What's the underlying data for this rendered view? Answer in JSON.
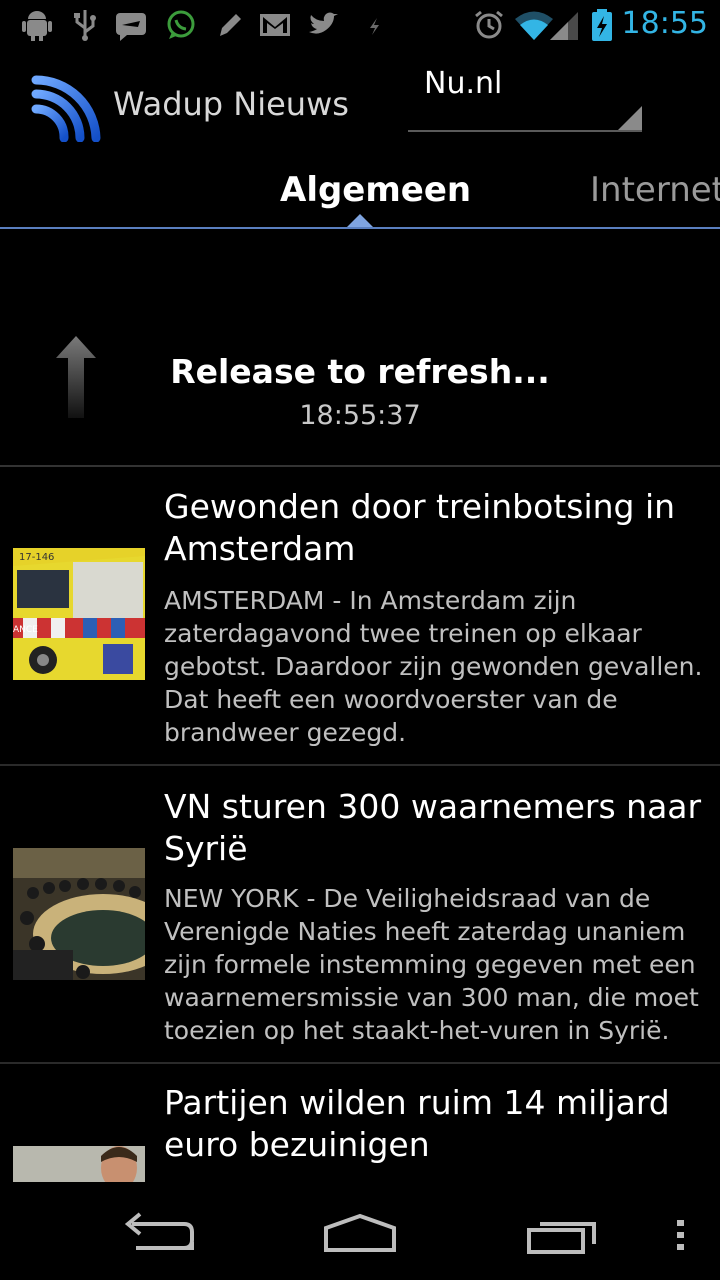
{
  "status_bar": {
    "time": "18:55",
    "left_icons": [
      "android-debug-icon",
      "usb-icon",
      "airplane-message-icon",
      "whatsapp-icon",
      "pencil-icon",
      "gmail-icon",
      "twitter-icon",
      "small-notification-icon"
    ],
    "right_icons": [
      "alarm-icon",
      "wifi-icon",
      "signal-icon",
      "battery-charging-icon"
    ]
  },
  "action_bar": {
    "app_title": "Wadup Nieuws",
    "source_selected": "Nu.nl"
  },
  "tabs": [
    {
      "label": "Algemeen",
      "selected": true
    },
    {
      "label": "Internet",
      "selected": false
    }
  ],
  "pull_to_refresh": {
    "message": "Release to refresh...",
    "time": "18:55:37"
  },
  "news": [
    {
      "headline": "Gewonden door treinbotsing in Amsterdam",
      "summary": "AMSTERDAM - In Amsterdam zijn zaterdagavond twee treinen op elkaar gebotst. Daardoor zijn gewonden gevallen. Dat heeft een woordvoerster van de brandweer gezegd.",
      "thumb_badge": "17-146",
      "thumb_side_text": "ANCE"
    },
    {
      "headline": "VN sturen 300 waarnemers naar Syrië",
      "summary": "NEW YORK - De Veiligheidsraad van de Verenigde Naties heeft zaterdag unaniem zijn formele instemming gegeven met een waarnemersmissie van 300 man, die moet toezien op het staakt-het-vuren in Syrië.",
      "thumb_badge": "",
      "thumb_side_text": ""
    },
    {
      "headline": "Partijen wilden ruim 14 miljard euro bezuinigen",
      "summary": "",
      "thumb_badge": "",
      "thumb_side_text": ""
    }
  ],
  "colors": {
    "accent": "#33b5e5",
    "tab_indicator": "#5a7fbf",
    "background": "#000000"
  }
}
